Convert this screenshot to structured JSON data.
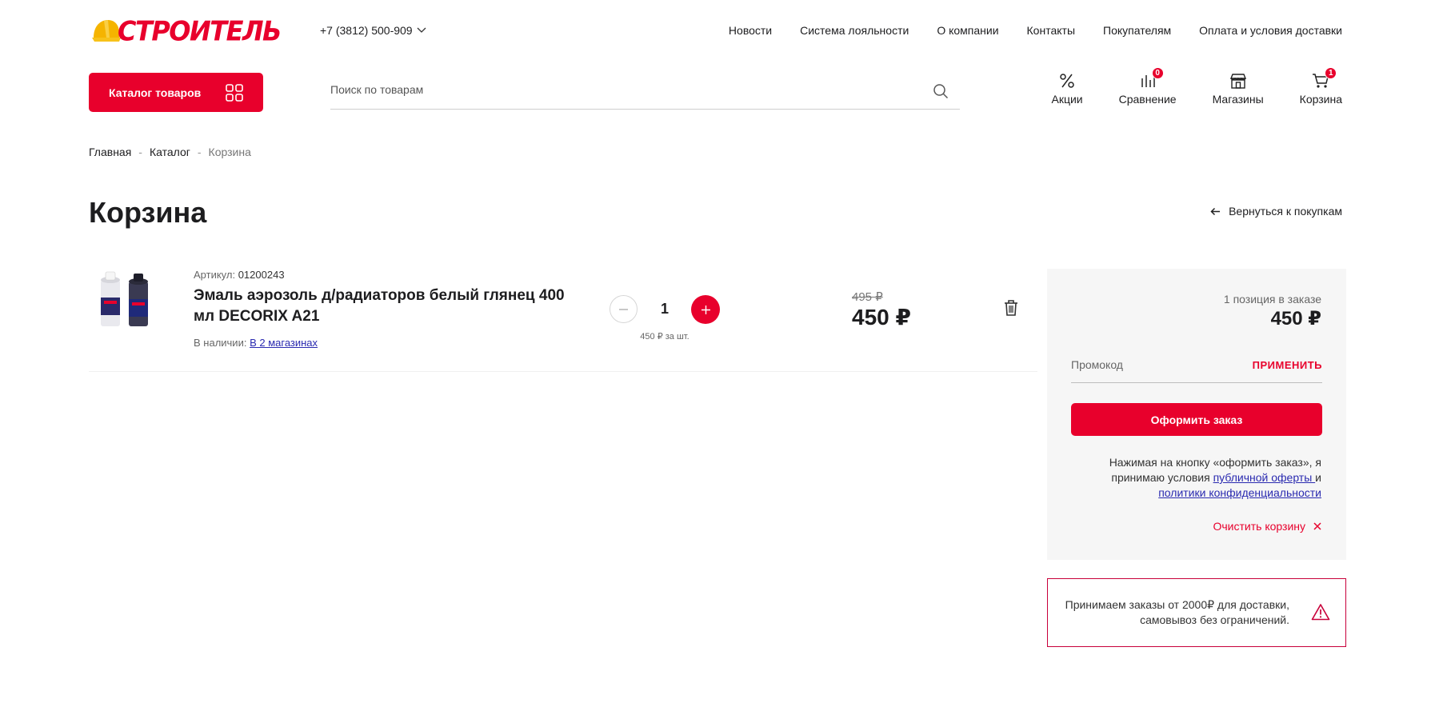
{
  "header": {
    "logo_text": "СТРОИТЕЛЬ",
    "phone": "+7 (3812) 500-909",
    "nav": [
      "Новости",
      "Система лояльности",
      "О компании",
      "Контакты",
      "Покупателям",
      "Оплата и условия доставки"
    ],
    "catalog_button": "Каталог товаров",
    "search_placeholder": "Поиск по товарам",
    "icons": {
      "promo": "Акции",
      "compare": "Сравнение",
      "compare_count": "0",
      "stores": "Магазины",
      "cart": "Корзина",
      "cart_count": "1"
    }
  },
  "breadcrumb": [
    "Главная",
    "Каталог",
    "Корзина"
  ],
  "page": {
    "title": "Корзина",
    "back_link": "Вернуться к покупкам"
  },
  "item": {
    "article_label": "Артикул:",
    "article": "01200243",
    "title": "Эмаль аэрозоль д/радиаторов белый глянец 400 мл DECORIX A21",
    "stock_label": "В наличии:",
    "stock_link": "В 2 магазинах",
    "quantity": "1",
    "unit_price": "450 ₽ за шт.",
    "old_price": "495 ₽",
    "price": "450 ₽"
  },
  "summary": {
    "positions": "1 позиция в заказе",
    "total": "450 ₽",
    "promo_placeholder": "Промокод",
    "promo_apply": "ПРИМЕНИТЬ",
    "order_button": "Оформить заказ",
    "terms_prefix": "Нажимая на кнопку «оформить заказ», я принимаю условия ",
    "terms_link1": "публичной оферты ",
    "terms_mid": "и ",
    "terms_link2": "политики конфиденциальности",
    "clear_cart": "Очистить корзину"
  },
  "notice": {
    "text": "Принимаем заказы от 2000₽ для доставки, самовывоз без ограничений."
  },
  "colors": {
    "brand_red": "#e8002c",
    "link_blue": "#2a2ab0"
  }
}
